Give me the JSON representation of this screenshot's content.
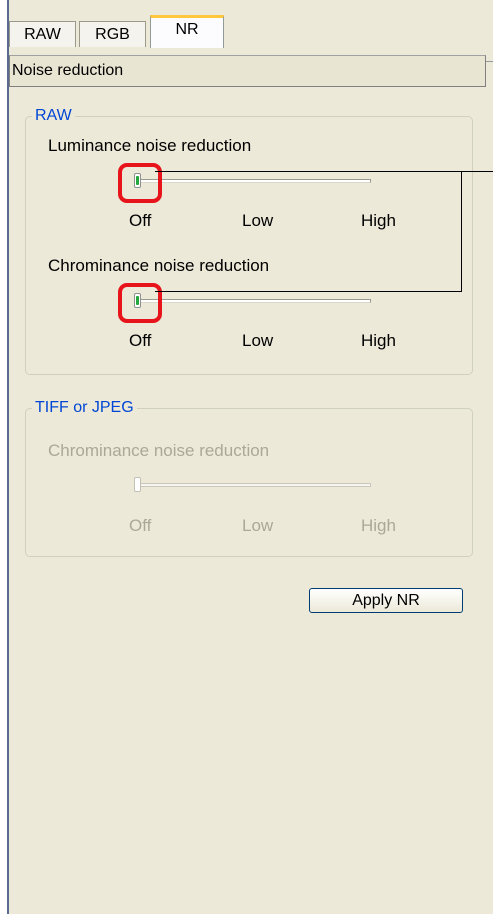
{
  "tabs": [
    {
      "label": "RAW",
      "active": false
    },
    {
      "label": "RGB",
      "active": false
    },
    {
      "label": "NR",
      "active": true
    }
  ],
  "section_title": "Noise reduction",
  "raw_group": {
    "legend": "RAW",
    "luminance": {
      "label": "Luminance noise reduction",
      "value": "Off",
      "ticks": [
        "Off",
        "Low",
        "High"
      ]
    },
    "chrominance": {
      "label": "Chrominance noise reduction",
      "value": "Off",
      "ticks": [
        "Off",
        "Low",
        "High"
      ]
    }
  },
  "tiff_group": {
    "legend": "TIFF or JPEG",
    "enabled": false,
    "chrominance": {
      "label": "Chrominance noise reduction",
      "value": "Off",
      "ticks": [
        "Off",
        "Low",
        "High"
      ]
    }
  },
  "apply_button": "Apply NR",
  "colors": {
    "panel_bg": "#ece9d8",
    "legend_text": "#0046d5",
    "highlight": "#e8141b",
    "active_tab_accent": "#ffc83c",
    "slider_led": "#22a83a"
  }
}
